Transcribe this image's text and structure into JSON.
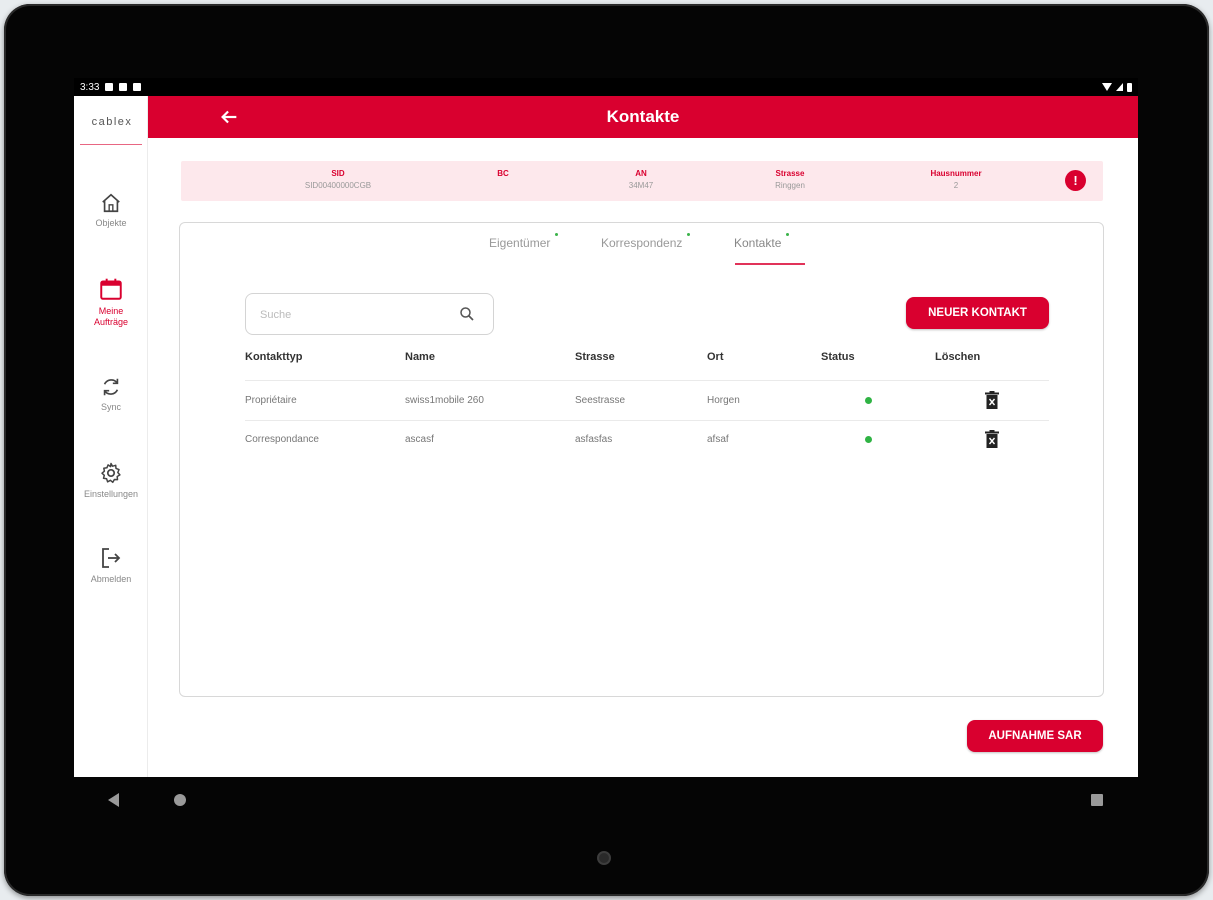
{
  "statusbar": {
    "time": "3:33"
  },
  "sidebar": {
    "logo": "cablex",
    "items": [
      {
        "label": "Objekte",
        "icon": "home-icon"
      },
      {
        "label": "Meine Aufträge",
        "icon": "calendar-icon",
        "active": true
      },
      {
        "label": "Sync",
        "icon": "sync-icon"
      },
      {
        "label": "Einstellungen",
        "icon": "gear-icon"
      },
      {
        "label": "Abmelden",
        "icon": "logout-icon"
      }
    ]
  },
  "appbar": {
    "title": "Kontakte",
    "back_icon": "arrow-left-icon"
  },
  "infobar": {
    "fields": [
      {
        "key": "SID",
        "value": "SID00400000CGB"
      },
      {
        "key": "BC",
        "value": ""
      },
      {
        "key": "AN",
        "value": "34M47"
      },
      {
        "key": "Strasse",
        "value": "Ringgen"
      },
      {
        "key": "Hausnummer",
        "value": "2"
      }
    ],
    "info_icon": "info-icon"
  },
  "tabs": [
    {
      "label": "Eigentümer",
      "active": false
    },
    {
      "label": "Korrespondenz",
      "active": false
    },
    {
      "label": "Kontakte",
      "active": true
    }
  ],
  "search": {
    "placeholder": "Suche",
    "value": ""
  },
  "buttons": {
    "new_contact": "NEUER KONTAKT",
    "save": "AUFNAHME SAR"
  },
  "table": {
    "headers": [
      "Kontakttyp",
      "Name",
      "Strasse",
      "Ort",
      "Status",
      "Löschen"
    ],
    "rows": [
      {
        "type": "Propriétaire",
        "name": "swiss1mobile 260",
        "street": "Seestrasse",
        "city": "Horgen",
        "status": "active"
      },
      {
        "type": "Correspondance",
        "name": "ascasf",
        "street": "asfasfas",
        "city": "afsaf",
        "status": "active"
      }
    ]
  },
  "colors": {
    "accent": "#d9002f",
    "status_ok": "#2fb344",
    "info_bg": "#fde8ec"
  }
}
